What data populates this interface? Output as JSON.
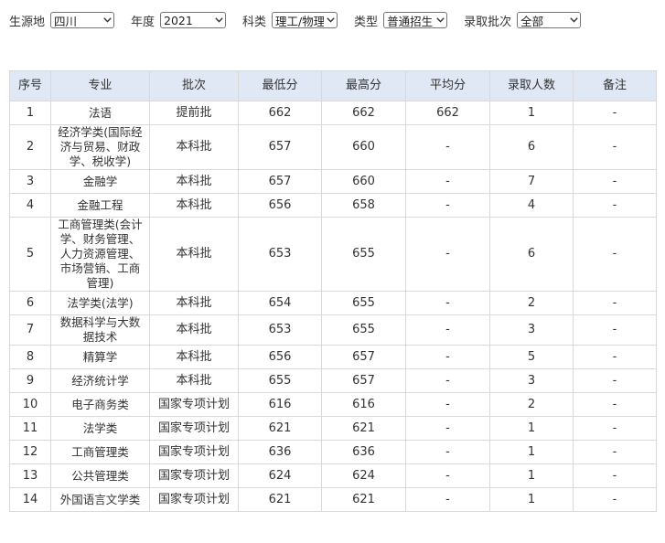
{
  "filters": [
    {
      "label": "生源地",
      "value": "四川",
      "width": 70
    },
    {
      "label": "年度",
      "value": "2021",
      "width": 72
    },
    {
      "label": "科类",
      "value": "理工/物理",
      "width": 72
    },
    {
      "label": "类型",
      "value": "普通招生",
      "width": 70
    },
    {
      "label": "录取批次",
      "value": "全部",
      "width": 70
    }
  ],
  "table": {
    "headers": [
      "序号",
      "专业",
      "批次",
      "最低分",
      "最高分",
      "平均分",
      "录取人数",
      "备注"
    ],
    "rows": [
      [
        "1",
        "法语",
        "提前批",
        "662",
        "662",
        "662",
        "1",
        "-"
      ],
      [
        "2",
        "经济学类(国际经济与贸易、财政学、税收学)",
        "本科批",
        "657",
        "660",
        "-",
        "6",
        "-"
      ],
      [
        "3",
        "金融学",
        "本科批",
        "657",
        "660",
        "-",
        "7",
        "-"
      ],
      [
        "4",
        "金融工程",
        "本科批",
        "656",
        "658",
        "-",
        "4",
        "-"
      ],
      [
        "5",
        "工商管理类(会计学、财务管理、人力资源管理、市场营销、工商管理)",
        "本科批",
        "653",
        "655",
        "-",
        "6",
        "-"
      ],
      [
        "6",
        "法学类(法学)",
        "本科批",
        "654",
        "655",
        "-",
        "2",
        "-"
      ],
      [
        "7",
        "数据科学与大数据技术",
        "本科批",
        "653",
        "655",
        "-",
        "3",
        "-"
      ],
      [
        "8",
        "精算学",
        "本科批",
        "656",
        "657",
        "-",
        "5",
        "-"
      ],
      [
        "9",
        "经济统计学",
        "本科批",
        "655",
        "657",
        "-",
        "3",
        "-"
      ],
      [
        "10",
        "电子商务类",
        "国家专项计划",
        "616",
        "616",
        "-",
        "2",
        "-"
      ],
      [
        "11",
        "法学类",
        "国家专项计划",
        "621",
        "621",
        "-",
        "1",
        "-"
      ],
      [
        "12",
        "工商管理类",
        "国家专项计划",
        "636",
        "636",
        "-",
        "1",
        "-"
      ],
      [
        "13",
        "公共管理类",
        "国家专项计划",
        "624",
        "624",
        "-",
        "1",
        "-"
      ],
      [
        "14",
        "外国语言文学类",
        "国家专项计划",
        "621",
        "621",
        "-",
        "1",
        "-"
      ]
    ]
  }
}
